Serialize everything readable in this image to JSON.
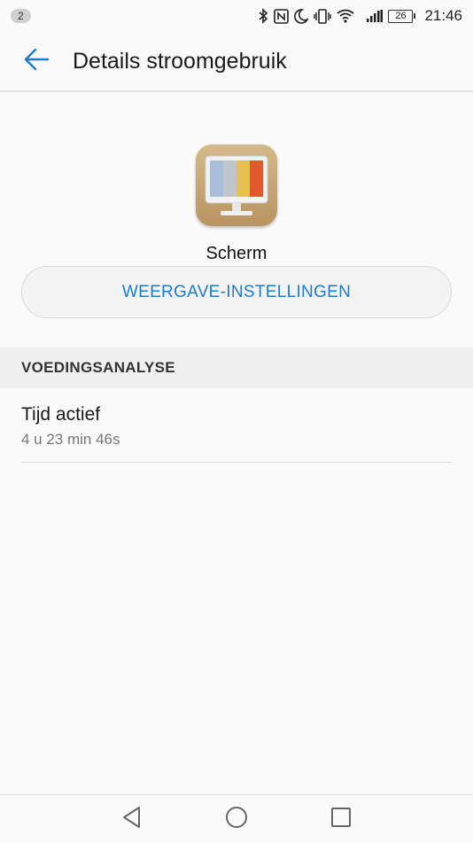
{
  "status_bar": {
    "notification_count": "2",
    "icons": [
      "bluetooth-icon",
      "nfc-icon",
      "moon-icon",
      "vibrate-icon",
      "wifi-icon",
      "signal-icon"
    ],
    "battery_level": "26",
    "time": "21:46"
  },
  "header": {
    "title": "Details stroomgebruik",
    "back_icon": "arrow-left-icon"
  },
  "app": {
    "icon": "monitor-icon",
    "name": "Scherm",
    "settings_button_label": "WEERGAVE-INSTELLINGEN"
  },
  "section": {
    "title": "VOEDINGSANALYSE",
    "items": [
      {
        "title": "Tijd actief",
        "value": "4 u 23 min 46s"
      }
    ]
  },
  "nav_bar": {
    "buttons": [
      "back-triangle-icon",
      "home-circle-icon",
      "recents-square-icon"
    ]
  },
  "colors": {
    "accent": "#1e7bd0",
    "background": "#fafafa",
    "section_background": "#f0f0f0"
  }
}
